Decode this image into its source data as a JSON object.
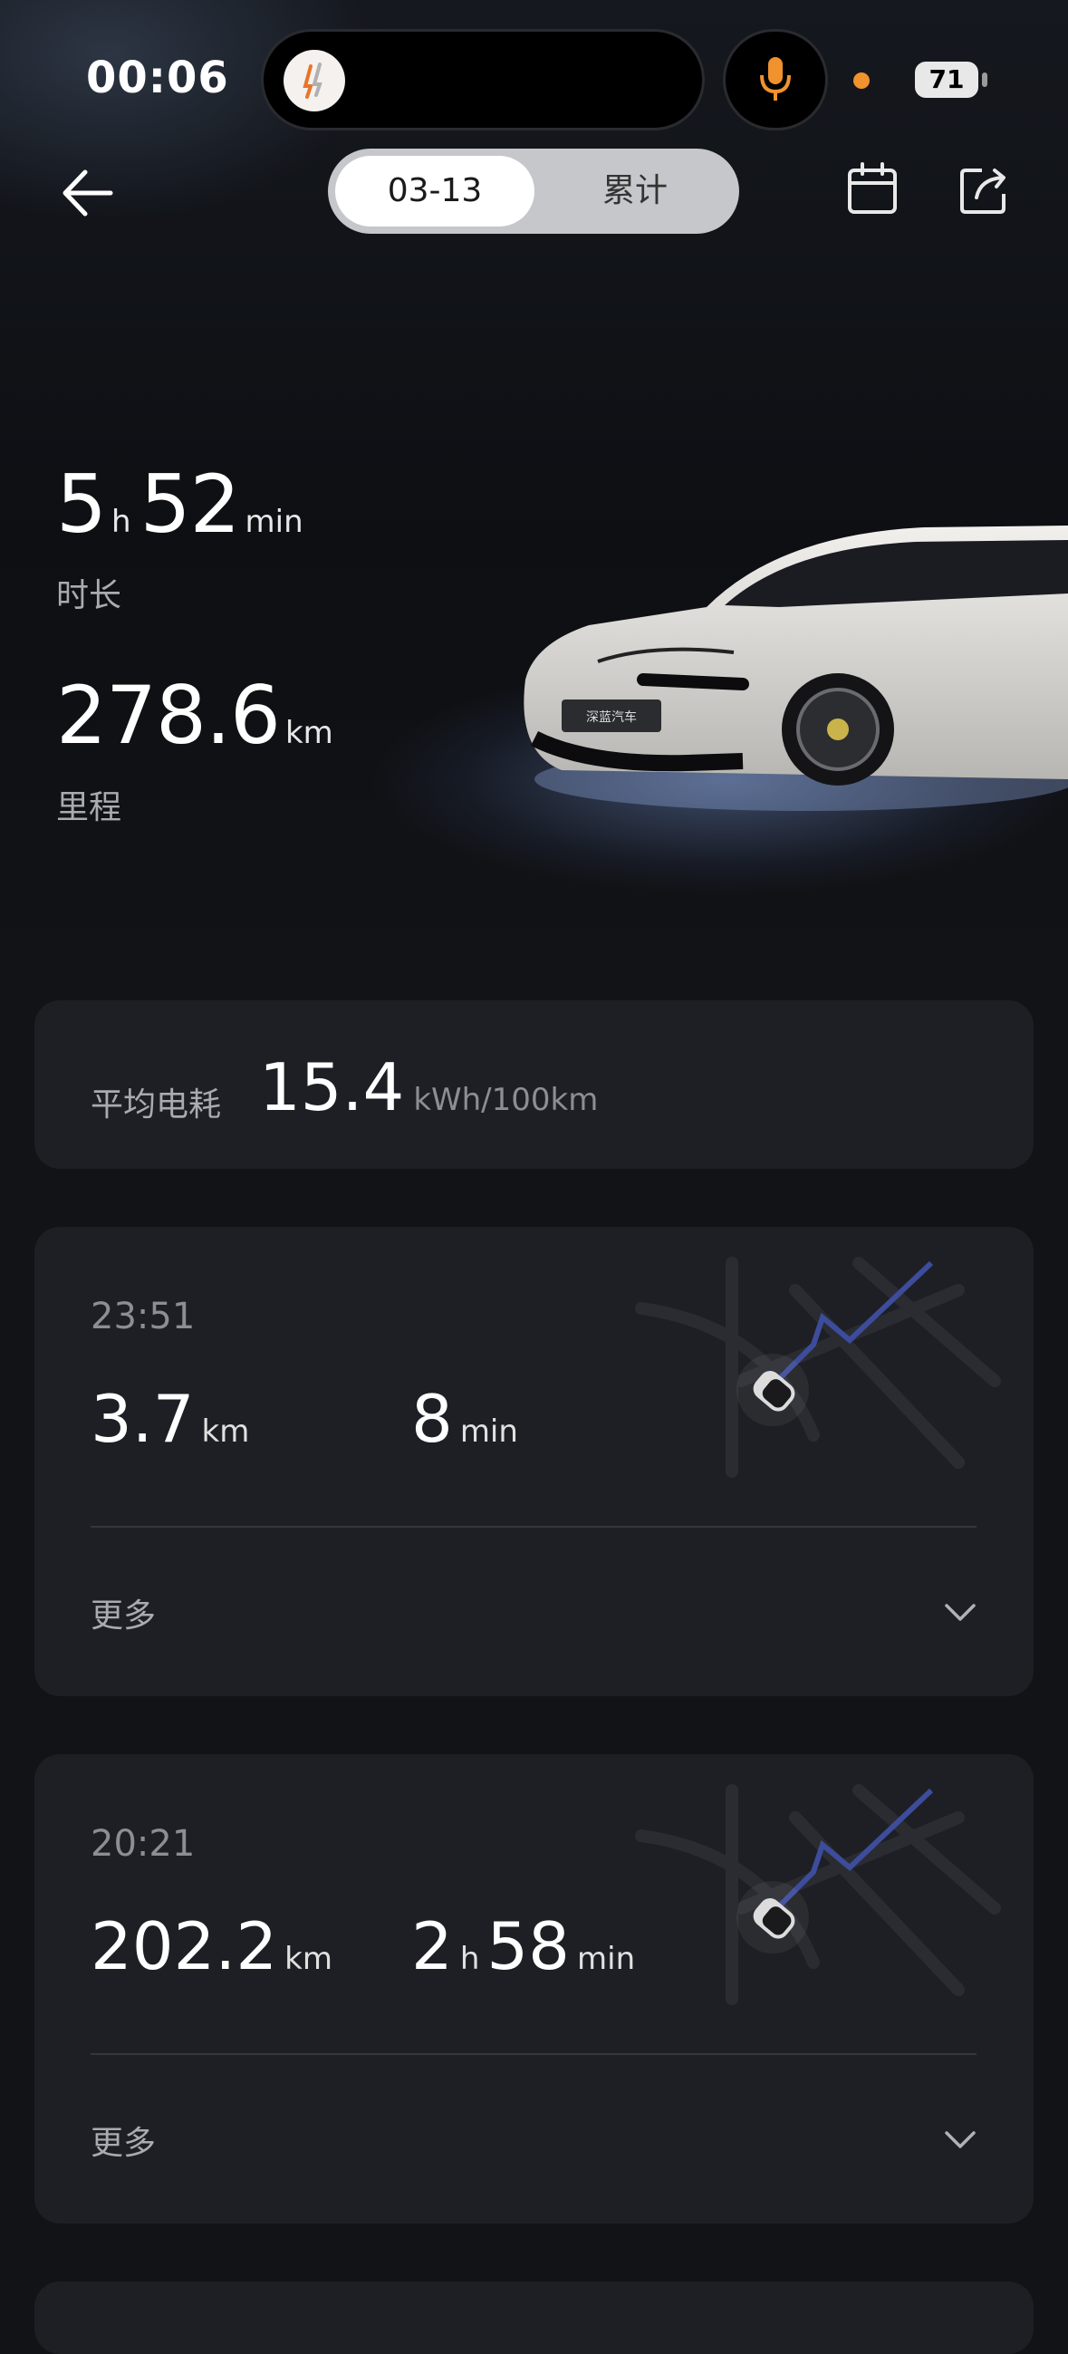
{
  "status_bar": {
    "time": "00:06",
    "battery": "71"
  },
  "segment": {
    "date_tab": "03-13",
    "total_tab": "累计"
  },
  "summary": {
    "hours": "5",
    "hours_unit": "h",
    "minutes": "52",
    "minutes_unit": "min",
    "duration_label": "时长",
    "mileage": "278.6",
    "mileage_unit": "km",
    "mileage_label": "里程"
  },
  "avg_consumption": {
    "label": "平均电耗",
    "value": "15.4",
    "unit": "kWh/100km"
  },
  "trips": [
    {
      "time": "23:51",
      "distance": "3.7",
      "distance_unit": "km",
      "duration_min": "8",
      "min_unit": "min",
      "more": "更多"
    },
    {
      "time": "20:21",
      "distance": "202.2",
      "distance_unit": "km",
      "duration_h": "2",
      "h_unit": "h",
      "duration_min": "58",
      "min_unit": "min",
      "more": "更多"
    }
  ],
  "colors": {
    "background": "#121316",
    "card": "#1e1f24",
    "route": "#3d4c9b",
    "accent_dot": "#f0922d"
  },
  "icons": [
    "back-arrow-icon",
    "calendar-icon",
    "share-icon",
    "mic-icon",
    "chevron-down-icon"
  ]
}
